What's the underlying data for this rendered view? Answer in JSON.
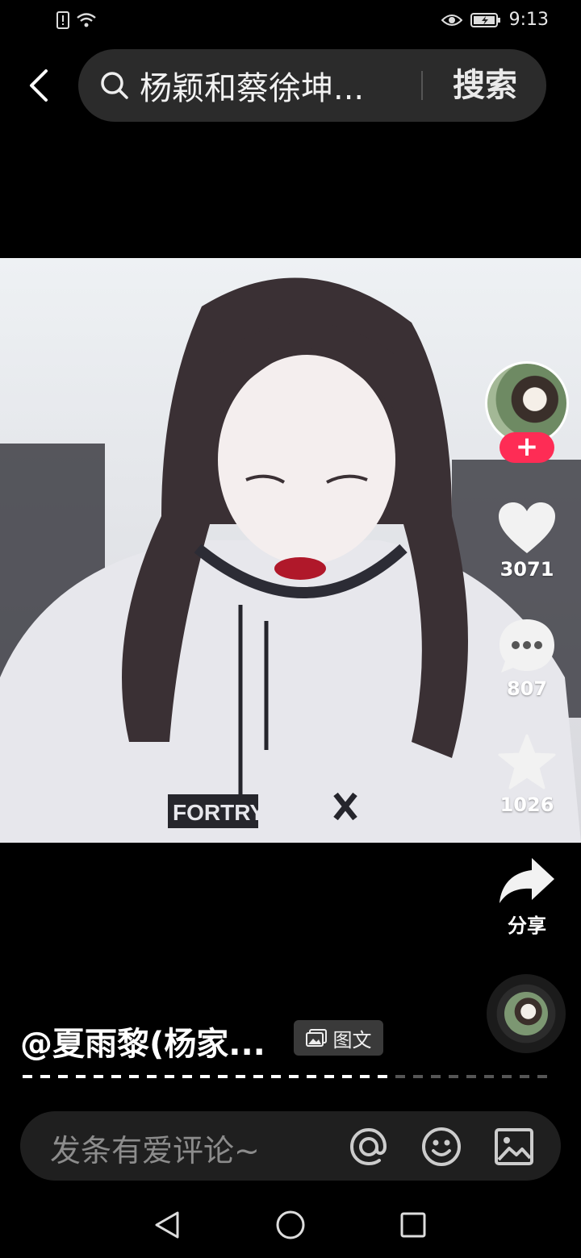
{
  "status_bar": {
    "time": "9:13"
  },
  "search": {
    "query": "杨颖和蔡徐坤...",
    "button_label": "搜索"
  },
  "video": {
    "description": "portrait photo: girl in white hoodie with pigtails",
    "hoodie_text": "FORTRY"
  },
  "actions": {
    "likes": "3071",
    "comments": "807",
    "favorites": "1026",
    "share_label": "分享"
  },
  "follow_symbol": "+",
  "post": {
    "author": "@夏雨黎(杨家...",
    "tag_label": "图文",
    "progress_fraction": 0.7
  },
  "comment_bar": {
    "placeholder": "发条有爱评论~"
  },
  "colors": {
    "accent": "#fe2c55",
    "background": "#000000",
    "input_background": "#2b2b2b"
  }
}
